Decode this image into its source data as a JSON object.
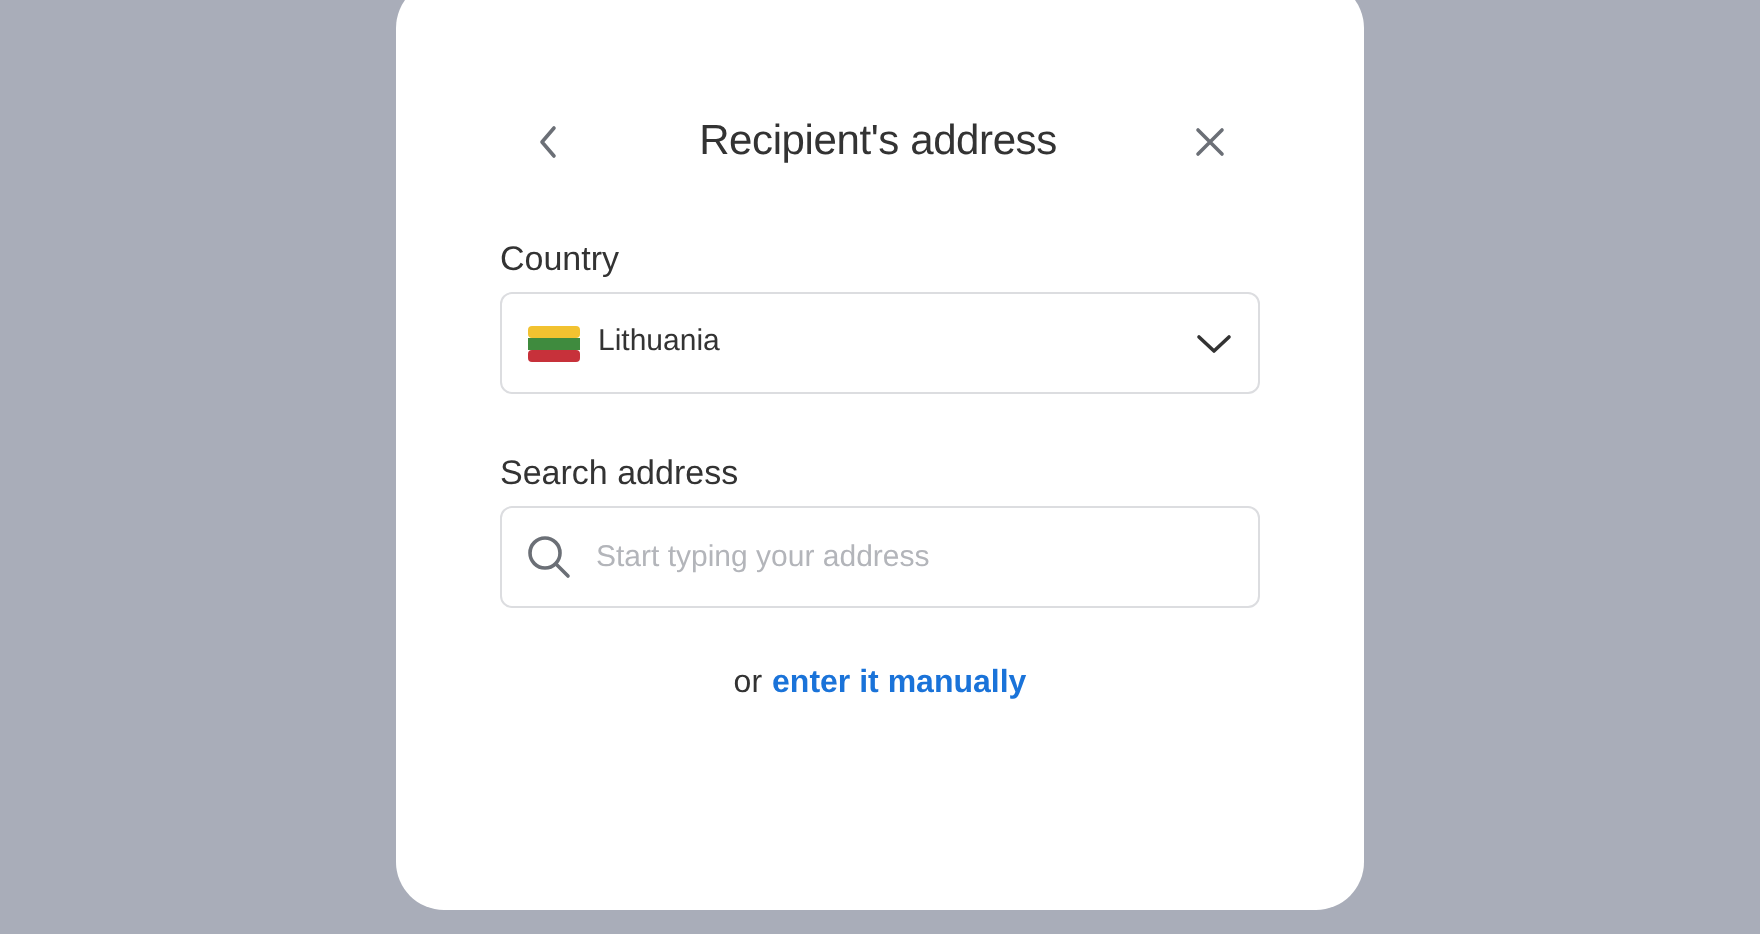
{
  "dialog": {
    "title": "Recipient's address"
  },
  "country": {
    "label": "Country",
    "value": "Lithuania"
  },
  "search": {
    "label": "Search address",
    "placeholder": "Start typing your address"
  },
  "manual": {
    "prefix": "or",
    "link": "enter it manually"
  }
}
